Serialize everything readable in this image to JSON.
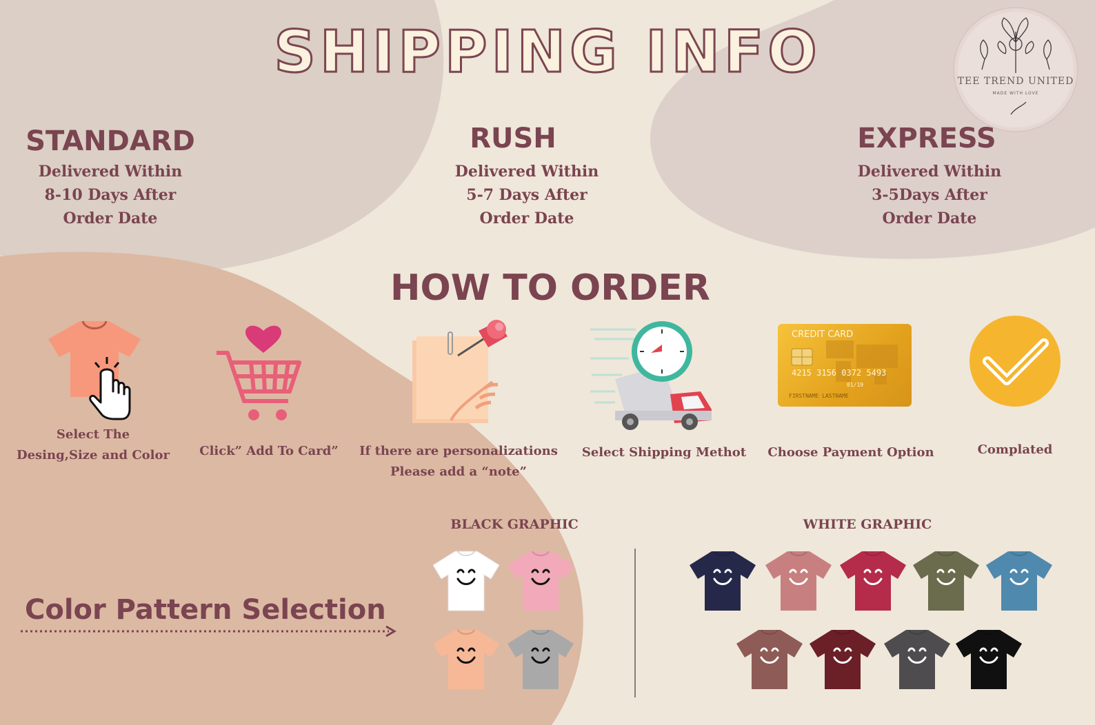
{
  "title": "SHIPPING INFO",
  "logo": {
    "name": "TEE TREND UNITED",
    "tagline": "MADE WITH LOVE"
  },
  "tiers": [
    {
      "name": "STANDARD",
      "lines": [
        "Delivered Within",
        "8-10 Days After",
        "Order Date"
      ]
    },
    {
      "name": "RUSH",
      "lines": [
        "Delivered Within",
        "5-7 Days After",
        "Order Date"
      ]
    },
    {
      "name": "EXPRESS",
      "lines": [
        "Delivered Within",
        "3-5Days After",
        "Order Date"
      ]
    }
  ],
  "how_to_order": {
    "title": "HOW TO ORDER",
    "steps": [
      {
        "lines": [
          "Select The",
          "Desing,Size and Color"
        ],
        "icon": "tshirt-pointer-icon"
      },
      {
        "lines": [
          "Click” Add To Card”"
        ],
        "icon": "shopping-cart-heart-icon"
      },
      {
        "lines": [
          "If there are personalizations",
          "Please add a “note”"
        ],
        "icon": "pinned-note-icon"
      },
      {
        "lines": [
          "Select Shipping Methot"
        ],
        "icon": "delivery-truck-clock-icon"
      },
      {
        "lines": [
          "Choose Payment Option"
        ],
        "icon": "credit-card-icon"
      },
      {
        "lines": [
          "Complated"
        ],
        "icon": "check-circle-icon"
      }
    ]
  },
  "credit_card": {
    "label": "CREDIT CARD",
    "number": "4215  3156  0372  5493",
    "expiry": "01/19",
    "holder": "FIRSTNAME  LASTNAME"
  },
  "color_pattern": {
    "title": "Color Pattern Selection",
    "black_graphic": {
      "label": "BLACK GRAPHIC",
      "colors": [
        "#ffffff",
        "#f2a9b9",
        "#f6b896",
        "#a9a9a9"
      ]
    },
    "white_graphic": {
      "label": "WHITE GRAPHIC",
      "colors": [
        "#26284a",
        "#c7807f",
        "#b52b4a",
        "#6b6b4d",
        "#4f89ad",
        "#8f5b56",
        "#6b1f26",
        "#4f4c4f",
        "#101010"
      ]
    }
  },
  "colors": {
    "accent": "#7a4450",
    "background": "#efe7da"
  }
}
